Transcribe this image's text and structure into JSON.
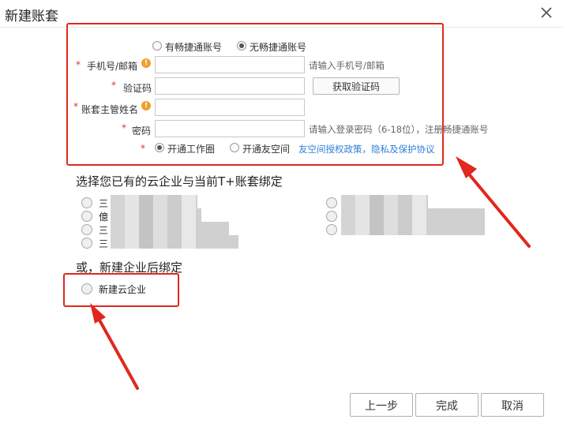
{
  "dialog": {
    "title": "新建账套"
  },
  "account_type": {
    "options": [
      "有畅捷通账号",
      "无畅捷通账号"
    ],
    "selected": "无畅捷通账号"
  },
  "form": {
    "phone": {
      "label": "手机号/邮箱",
      "value": "",
      "hint": "请输入手机号/邮箱"
    },
    "code": {
      "label": "验证码",
      "value": "",
      "button": "获取验证码"
    },
    "manager": {
      "label": "账套主管姓名",
      "value": ""
    },
    "password": {
      "label": "密码",
      "value": "",
      "hint": "请输入登录密码（6-18位），注册畅捷通账号"
    },
    "services": {
      "options": [
        "开通工作圈",
        "开通友空间"
      ],
      "selected": "开通工作圈",
      "policy_link": "友空间授权政策，隐私及保护协议"
    }
  },
  "bind_existing": {
    "heading": "选择您已有的云企业与当前T+账套绑定",
    "left_items": [
      "三",
      "億",
      "三",
      "三"
    ],
    "right_count": 3
  },
  "bind_new": {
    "heading": "或，新建企业后绑定",
    "option": "新建云企业"
  },
  "footer": {
    "prev": "上一步",
    "finish": "完成",
    "cancel": "取消"
  },
  "colors": {
    "annotation_red": "#e0281e",
    "link_blue": "#2f7fd4",
    "required_red": "#e53333"
  }
}
